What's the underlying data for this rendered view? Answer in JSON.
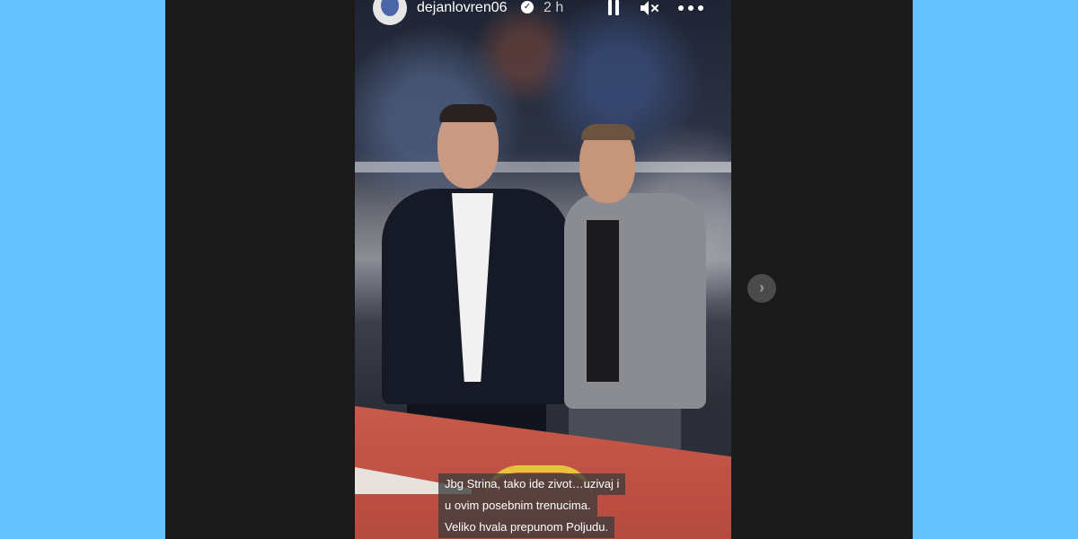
{
  "story": {
    "username": "dejanlovren06",
    "verified_badge": "✓",
    "time_ago": "2 h",
    "caption_lines": [
      "Jbg Strina, tako ide zivot…uzivaj i",
      "u ovim posebnim trenucima.",
      "Veliko hvala prepunom Poljudu."
    ]
  },
  "icons": {
    "pause": "pause-icon",
    "mute": "speaker-muted-icon",
    "more": "more-options-icon",
    "next": "chevron-right-icon"
  },
  "controls": {
    "next_glyph": "›"
  },
  "colors": {
    "page_background": "#66c2ff",
    "viewer_background": "#1a1a1a",
    "caption_background": "#3c3c3c"
  }
}
